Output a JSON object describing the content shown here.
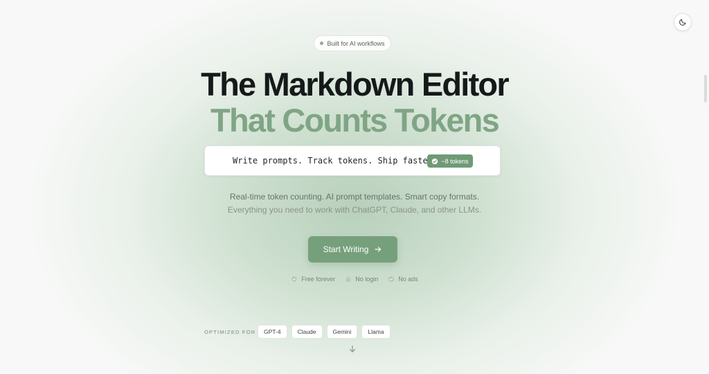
{
  "header": {
    "theme_toggle_icon": "moon-icon"
  },
  "hero": {
    "badge": "Built for AI workflows",
    "title_line1": "The Markdown Editor",
    "title_line2": "That Counts Tokens",
    "prompt_example": "Write prompts. Track tokens. Ship faster.",
    "token_count": "~8 tokens",
    "subtitle_line1": "Real-time token counting. AI prompt templates. Smart copy formats.",
    "subtitle_line2": "Everything you need to work with ChatGPT, Claude, and other LLMs.",
    "cta_label": "Start Writing"
  },
  "features": [
    {
      "label": "Free forever",
      "icon": "shield-icon"
    },
    {
      "label": "No login",
      "icon": "lock-icon"
    },
    {
      "label": "No ads",
      "icon": "check-icon"
    }
  ],
  "optimized": {
    "label": "OPTIMIZED FOR",
    "models": [
      "GPT-4",
      "Claude",
      "Gemini",
      "Llama"
    ]
  },
  "colors": {
    "accent": "#76a07c",
    "title_dark": "#16191a",
    "title_green": "#7fa585"
  }
}
